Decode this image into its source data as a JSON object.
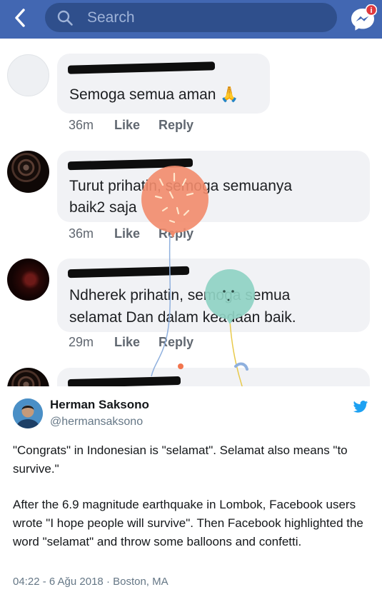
{
  "app_bar": {
    "search_placeholder": "Search",
    "icons": {
      "back": "back-arrow-icon",
      "search": "search-icon",
      "messenger": "messenger-icon"
    },
    "colors": {
      "bar": "#4267b2",
      "search_field": "#2f4f8c"
    }
  },
  "comments": [
    {
      "text_lines": [
        "Semoga semua aman 🙏"
      ],
      "time": "36m",
      "like": "Like",
      "reply": "Reply",
      "avatar": "blank"
    },
    {
      "text_lines": [
        "Turut prihatin, semoga semuanya",
        "baik2 saja"
      ],
      "time": "36m",
      "like": "Like",
      "reply": "Reply",
      "avatar": "dark"
    },
    {
      "text_lines": [
        "Ndherek prihatin, semoga semua",
        "selamat Dan dalam keadaan baik."
      ],
      "time": "29m",
      "like": "Like",
      "reply": "Reply",
      "avatar": "red"
    }
  ],
  "decorations": [
    "orange-balloon",
    "teal-balloon",
    "confetti"
  ],
  "tweet": {
    "name": "Herman Saksono",
    "handle": "@hermansaksono",
    "paragraphs": [
      "\"Congrats\" in Indonesian is \"selamat\". Selamat also means \"to survive.\"",
      "After the 6.9 magnitude earthquake in Lombok, Facebook users wrote \"I hope people will survive\". Then Facebook highlighted the word \"selamat\" and throw some balloons and confetti."
    ],
    "timestamp": "04:22 - 6 Ağu 2018 · Boston, MA",
    "brand_color": "#1da1f2"
  }
}
